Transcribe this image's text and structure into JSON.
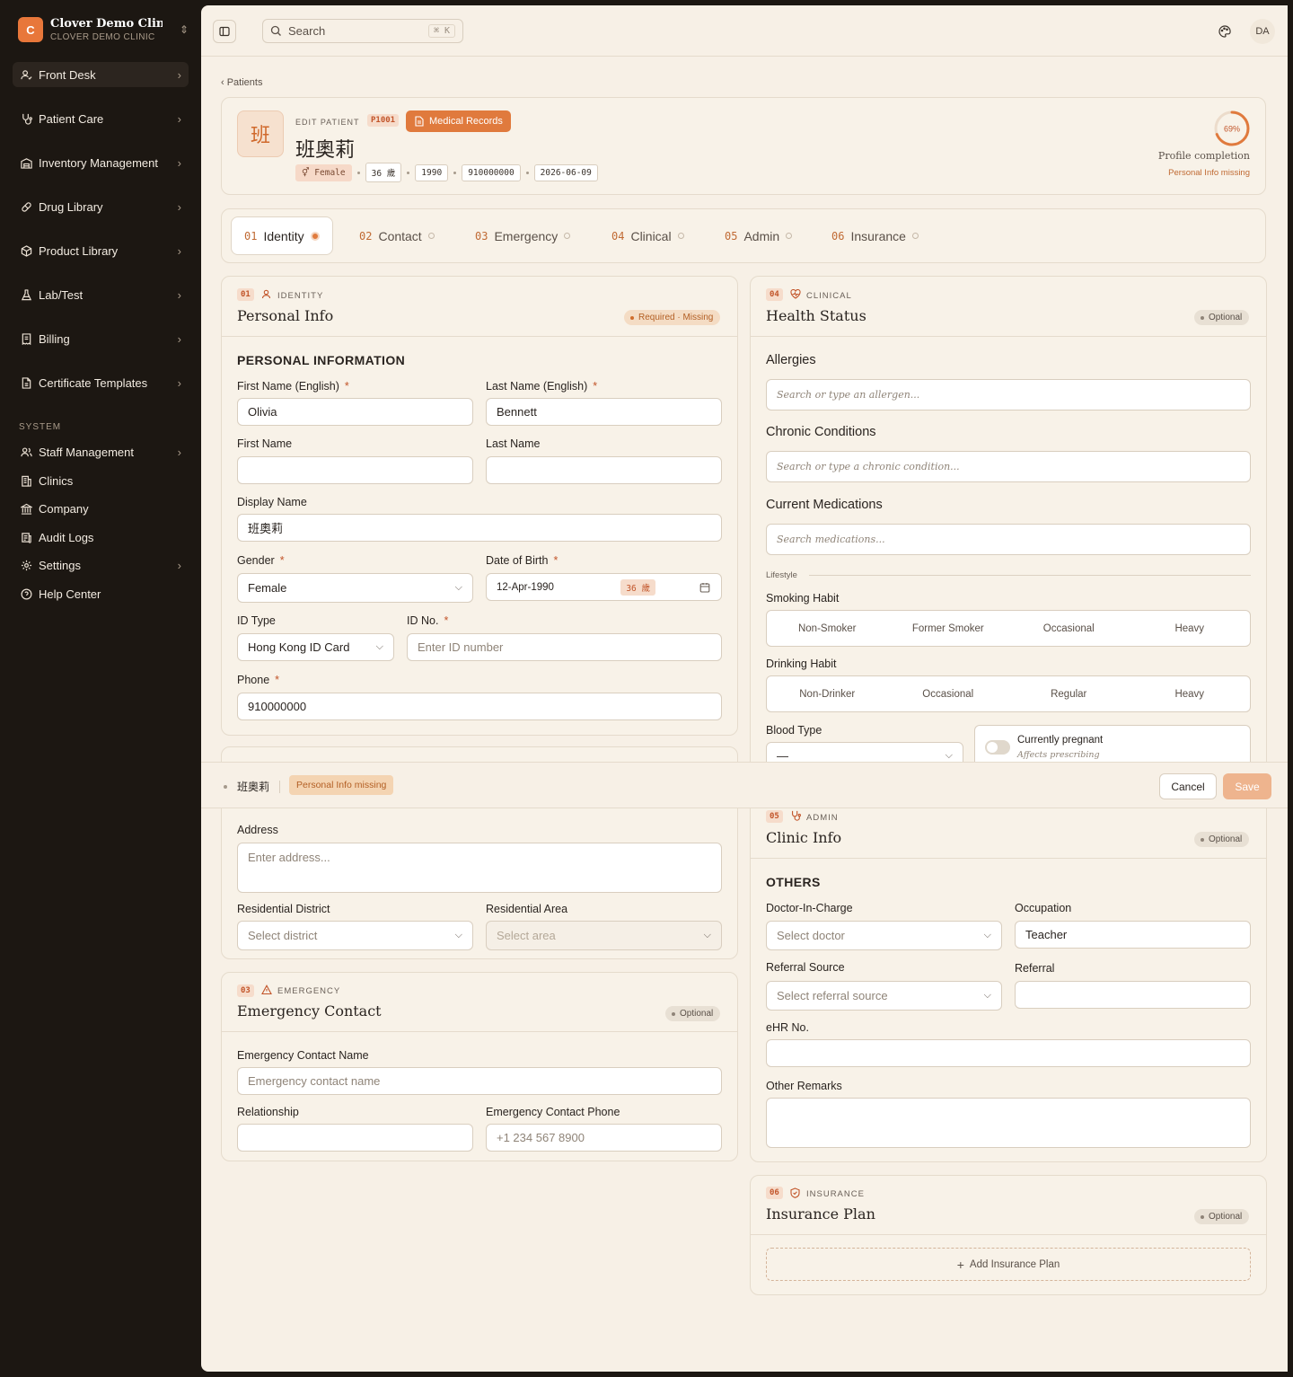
{
  "brand": {
    "initial": "C",
    "name": "Clover Demo Clini...",
    "sub": "CLOVER DEMO CLINIC"
  },
  "nav": [
    {
      "label": "Front Desk",
      "icon": "user-check-icon"
    },
    {
      "label": "Patient Care",
      "icon": "stethoscope-icon"
    },
    {
      "label": "Inventory Management",
      "icon": "warehouse-icon"
    },
    {
      "label": "Drug Library",
      "icon": "pill-icon"
    },
    {
      "label": "Product Library",
      "icon": "package-icon"
    },
    {
      "label": "Lab/Test",
      "icon": "flask-icon"
    },
    {
      "label": "Billing",
      "icon": "receipt-icon"
    },
    {
      "label": "Certificate Templates",
      "icon": "file-icon"
    }
  ],
  "system_label": "SYSTEM",
  "system_nav": [
    {
      "label": "Staff Management",
      "icon": "users-icon"
    },
    {
      "label": "Clinics",
      "icon": "building-icon"
    },
    {
      "label": "Company",
      "icon": "landmark-icon"
    },
    {
      "label": "Audit Logs",
      "icon": "logs-icon"
    },
    {
      "label": "Settings",
      "icon": "gear-icon"
    },
    {
      "label": "Help Center",
      "icon": "help-icon"
    }
  ],
  "topbar": {
    "search_placeholder": "Search",
    "shortcut": "⌘ K",
    "user_initials": "DA"
  },
  "breadcrumb": "‹ Patients",
  "patient": {
    "avatar_char": "班",
    "edit_label": "EDIT PATIENT",
    "id": "P1001",
    "medical_records": "Medical Records",
    "name": "班奧莉",
    "chips": [
      "⚥ Female",
      "36 歲",
      "1990",
      "910000000",
      "2026-06-09"
    ],
    "completion_pct": "69%",
    "completion_value": 0.69,
    "completion_label": "Profile completion",
    "completion_note": "Personal Info missing"
  },
  "tabs": [
    {
      "num": "01",
      "label": "Identity"
    },
    {
      "num": "02",
      "label": "Contact"
    },
    {
      "num": "03",
      "label": "Emergency"
    },
    {
      "num": "04",
      "label": "Clinical"
    },
    {
      "num": "05",
      "label": "Admin"
    },
    {
      "num": "06",
      "label": "Insurance"
    }
  ],
  "identity": {
    "num": "01",
    "cat": "IDENTITY",
    "title": "Personal Info",
    "badge": "Required · Missing",
    "heading": "PERSONAL INFORMATION",
    "first_en_label": "First Name (English)",
    "first_en": "Olivia",
    "last_en_label": "Last Name (English)",
    "last_en": "Bennett",
    "first_label": "First Name",
    "last_label": "Last Name",
    "display_label": "Display Name",
    "display": "班奧莉",
    "gender_label": "Gender",
    "gender": "Female",
    "dob_label": "Date of Birth",
    "dob": "12-Apr-1990",
    "dob_age": "36 歲",
    "idtype_label": "ID Type",
    "idtype": "Hong Kong ID Card",
    "idno_label": "ID No.",
    "idno_placeholder": "Enter ID number",
    "phone_label": "Phone",
    "phone": "910000000"
  },
  "contact": {
    "address_label": "Address",
    "address_placeholder": "Enter address...",
    "district_label": "Residential District",
    "district_placeholder": "Select district",
    "area_label": "Residential Area",
    "area_placeholder": "Select area"
  },
  "emergency": {
    "num": "03",
    "cat": "EMERGENCY",
    "title": "Emergency Contact",
    "badge": "Optional",
    "name_label": "Emergency Contact Name",
    "name_placeholder": "Emergency contact name",
    "rel_label": "Relationship",
    "phone_label": "Emergency Contact Phone",
    "phone_placeholder": "+1 234 567 8900"
  },
  "clinical": {
    "num": "04",
    "cat": "CLINICAL",
    "title": "Health Status",
    "badge": "Optional",
    "allergies": "Allergies",
    "allergies_ph": "Search or type an allergen...",
    "chronic": "Chronic Conditions",
    "chronic_ph": "Search or type a chronic condition...",
    "meds": "Current Medications",
    "meds_ph": "Search medications...",
    "lifestyle": "Lifestyle",
    "smoking_label": "Smoking Habit",
    "smoking": [
      "Non-Smoker",
      "Former Smoker",
      "Occasional",
      "Heavy"
    ],
    "drinking_label": "Drinking Habit",
    "drinking": [
      "Non-Drinker",
      "Occasional",
      "Regular",
      "Heavy"
    ],
    "blood_label": "Blood Type",
    "blood": "—",
    "pregnant": "Currently pregnant",
    "pregnant_note": "Affects prescribing"
  },
  "admin": {
    "num": "05",
    "cat": "ADMIN",
    "title": "Clinic Info",
    "badge": "Optional",
    "heading": "OTHERS",
    "doctor_label": "Doctor-In-Charge",
    "doctor_ph": "Select doctor",
    "occ_label": "Occupation",
    "occ": "Teacher",
    "refsrc_label": "Referral Source",
    "refsrc_ph": "Select referral source",
    "ref_label": "Referral",
    "ehr_label": "eHR No.",
    "remarks_label": "Other Remarks"
  },
  "insurance": {
    "num": "06",
    "cat": "INSURANCE",
    "title": "Insurance Plan",
    "badge": "Optional",
    "add": "Add Insurance Plan"
  },
  "bottombar": {
    "name": "班奧莉",
    "missing": "Personal Info missing",
    "cancel": "Cancel",
    "save": "Save"
  },
  "colors": {
    "accent": "#e07a3d",
    "sidebar": "#1c1712",
    "page": "#f7f0e6"
  }
}
